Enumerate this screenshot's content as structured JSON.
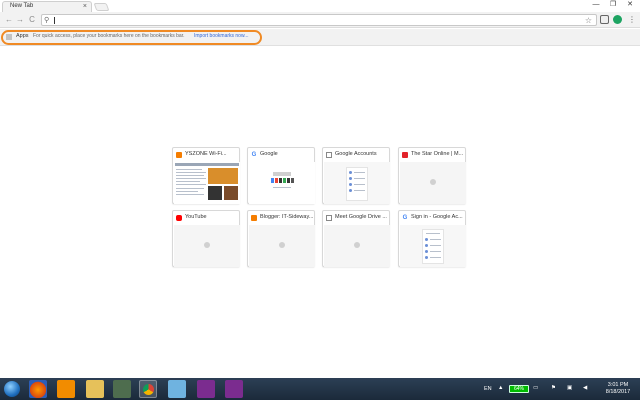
{
  "window": {
    "tab_title": "New Tab",
    "tab_close": "×",
    "minimize": "—",
    "maximize": "❐",
    "close": "✕"
  },
  "toolbar": {
    "back": "←",
    "forward": "→",
    "reload": "C",
    "omnibox_value": "",
    "star": "☆",
    "menu": "⋮"
  },
  "bookmarks": {
    "apps_label": "Apps",
    "hint": "For quick access, place your bookmarks here on the bookmarks bar.",
    "import_link": "Import bookmarks now..."
  },
  "tiles": [
    {
      "title": "YSZONE Wi-Fi...",
      "favicon": "blogger-icon",
      "favicon_color": "#f57d00",
      "thumb": "page"
    },
    {
      "title": "Google",
      "favicon": "google-g-icon",
      "favicon_color": "#4285f4",
      "thumb": "google"
    },
    {
      "title": "Google Accounts",
      "favicon": "document-icon",
      "favicon_color": "#888888",
      "thumb": "accounts"
    },
    {
      "title": "The Star Online | M...",
      "favicon": "thestar-icon",
      "favicon_color": "#e2232a",
      "thumb": "blank"
    },
    {
      "title": "YouTube",
      "favicon": "youtube-icon",
      "favicon_color": "#ff0000",
      "thumb": "blank"
    },
    {
      "title": "Blogger: IT-Sideway...",
      "favicon": "blogger-icon",
      "favicon_color": "#f57d00",
      "thumb": "blank"
    },
    {
      "title": "Meet Google Drive ...",
      "favicon": "document-icon",
      "favicon_color": "#888888",
      "thumb": "blank"
    },
    {
      "title": "Sign in - Google Ac...",
      "favicon": "google-g-icon",
      "favicon_color": "#4285f4",
      "thumb": "accounts"
    }
  ],
  "taskbar": {
    "language": "EN",
    "battery": "64%",
    "time": "3:01 PM",
    "date": "8/18/2017"
  },
  "colors": {
    "highlight": "#f08a24",
    "link": "#3367d6",
    "taskbar": "#1b2a3a"
  }
}
